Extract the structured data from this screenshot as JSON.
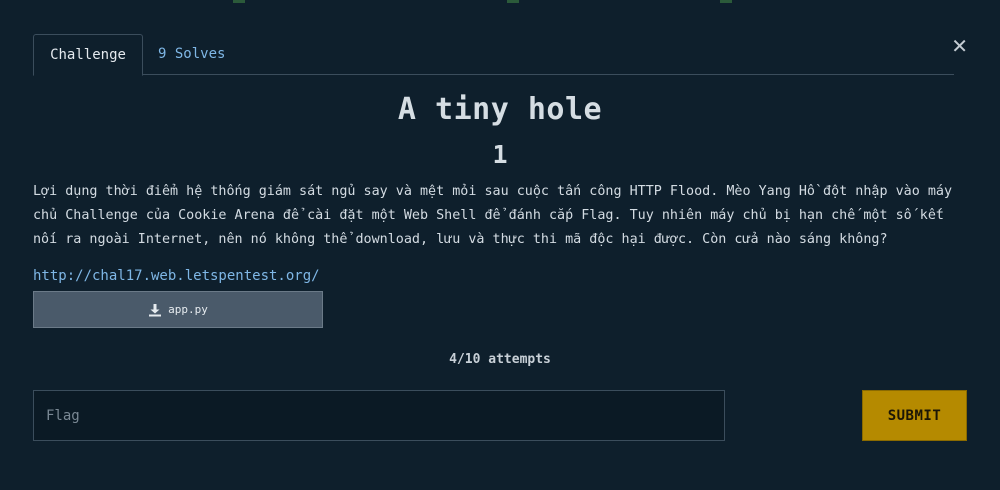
{
  "tabs": {
    "challenge_label": "Challenge",
    "solves_label": "9 Solves"
  },
  "close_icon": "close-icon",
  "challenge": {
    "title": "A tiny hole",
    "points": "1",
    "description": "Lợi dụng thời điểm hệ thống giám sát ngủ say và mệt mỏi sau cuộc tấn công HTTP Flood. Mèo Yang Hồ đột nhập vào máy chủ Challenge của Cookie Arena để cài đặt một Web Shell để đánh cắp Flag. Tuy nhiên máy chủ bị hạn chế một số kết nối ra ngoài Internet, nên nó không thể download, lưu và thực thi mã độc hại được. Còn cửa nào sáng không?",
    "link": "http://chal17.web.letspentest.org/",
    "file_name": "app.py",
    "file_icon": "download-icon"
  },
  "attempts": "4/10 attempts",
  "form": {
    "flag_placeholder": "Flag",
    "submit_label": "SUBMIT"
  },
  "colors": {
    "background": "#0e1f2c",
    "link": "#7fb7e6",
    "submit": "#b58a00",
    "file_button": "#4a5a6a"
  }
}
